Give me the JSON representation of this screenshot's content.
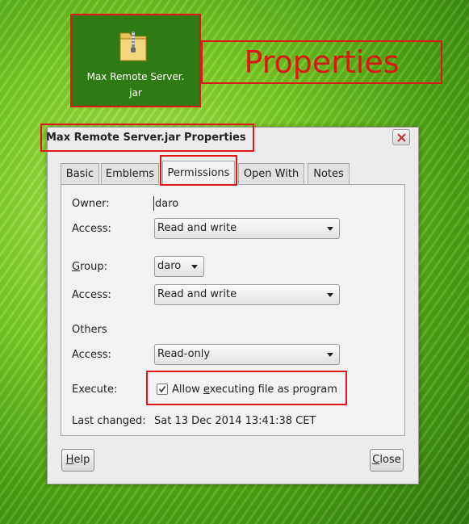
{
  "desktop": {
    "icon_label_line1": "Max Remote Server.",
    "icon_label_line2": "jar",
    "annotation": "Properties",
    "annotation_color": "#e01515"
  },
  "dialog": {
    "title": "Max Remote Server.jar Properties",
    "tabs": [
      "Basic",
      "Emblems",
      "Permissions",
      "Open With",
      "Notes"
    ],
    "active_tab": "Permissions",
    "owner_label": "Owner:",
    "owner_value": "daro",
    "access_label": "Access:",
    "owner_access": "Read and write",
    "group_label_prefix": "G",
    "group_label_rest": "roup:",
    "group_value": "daro",
    "group_access": "Read and write",
    "others_label": "Others",
    "others_access": "Read-only",
    "execute_label": "Execute:",
    "execute_checked": true,
    "execute_text_prefix": "Allow ",
    "execute_text_mnemonic": "e",
    "execute_text_rest": "xecuting file as program",
    "last_changed_label": "Last changed:",
    "last_changed_value": "Sat 13 Dec 2014 13:41:38 CET",
    "help_button_mnemonic": "H",
    "help_button_rest": "elp",
    "close_button_mnemonic": "C",
    "close_button_rest": "lose"
  },
  "icons": {
    "file_icon": "zip-archive-folder-icon",
    "window_close": "close-icon",
    "combo_arrow": "chevron-down-icon",
    "checkbox": "checkmark-icon"
  }
}
